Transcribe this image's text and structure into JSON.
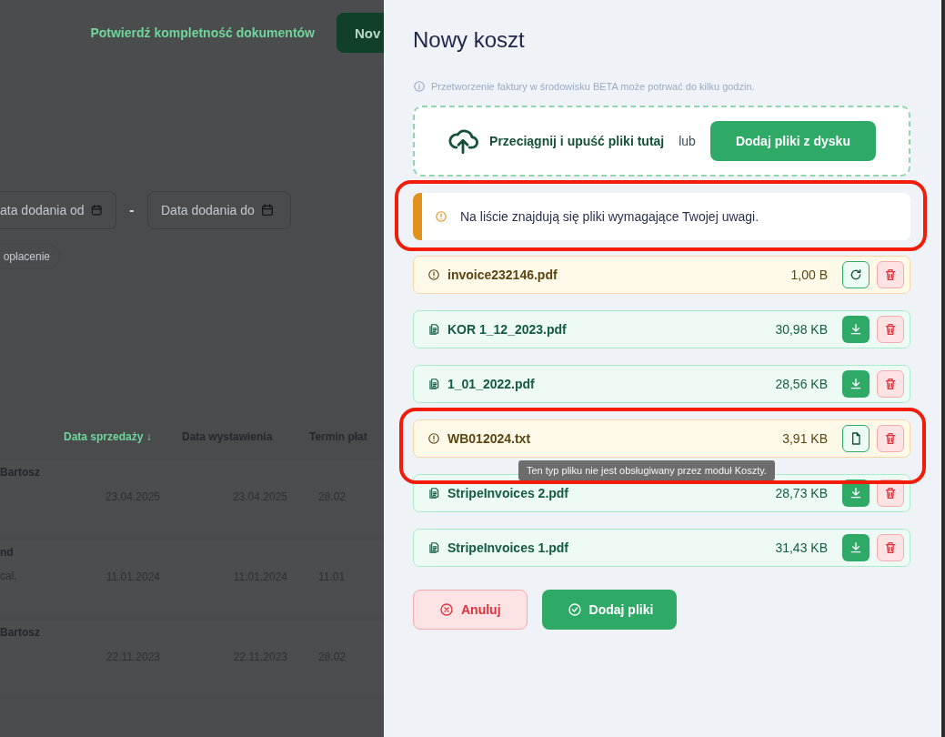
{
  "background": {
    "confirm_link": "Potwierdź kompletność dokumentów",
    "new_button": "Nov",
    "date_from": {
      "placeholder": "ata dodania od"
    },
    "date_separator": "-",
    "date_to": {
      "placeholder": "Data dodania do"
    },
    "chip": "opłacenie",
    "table": {
      "columns": [
        {
          "label": "Data sprzedaży",
          "sorted": true,
          "sort_icon": "↓"
        },
        {
          "label": "Data wystawienia",
          "sorted": false
        },
        {
          "label": "Termin płat",
          "sorted": false
        }
      ],
      "rows": [
        {
          "name": "Bartosz",
          "note": "",
          "cells": [
            "23.04.2025",
            "23.04.2025",
            "28.02"
          ]
        },
        {
          "name": "nd",
          "note": "cal,",
          "cells": [
            "11.01.2024",
            "11.01.2024",
            "11.01"
          ]
        },
        {
          "name": "Bartosz",
          "note": "",
          "cells": [
            "22.11.2023",
            "22.11.2023",
            "28.02"
          ]
        }
      ]
    }
  },
  "drawer": {
    "title": "Nowy koszt",
    "info": "Przetworzenie faktury w środowisku BETA może potrwać do kilku godzin.",
    "dropzone": {
      "label": "Przeciągnij i upuść pliki tutaj",
      "or": "lub",
      "button": "Dodaj pliki z dysku"
    },
    "alert": {
      "text": "Na liście znajdują się pliki wymagające Twojej uwagi.",
      "highlighted": true
    },
    "files": [
      {
        "kind": "warning",
        "name": "invoice232146.pdf",
        "size": "1,00 B",
        "highlighted": false
      },
      {
        "kind": "ok",
        "name": "KOR 1_12_2023.pdf",
        "size": "30,98 KB",
        "highlighted": false
      },
      {
        "kind": "ok",
        "name": "1_01_2022.pdf",
        "size": "28,56 KB",
        "highlighted": false
      },
      {
        "kind": "warning",
        "name": "WB012024.txt",
        "size": "3,91 KB",
        "highlighted": true,
        "tooltip": "Ten typ pliku nie jest obsługiwany przez moduł Koszty."
      },
      {
        "kind": "ok",
        "name": "StripeInvoices 2.pdf",
        "size": "28,73 KB",
        "highlighted": false
      },
      {
        "kind": "ok",
        "name": "StripeInvoices 1.pdf",
        "size": "31,43 KB",
        "highlighted": false
      }
    ],
    "cancel_button": "Anuluj",
    "submit_button": "Dodaj pliki"
  }
}
